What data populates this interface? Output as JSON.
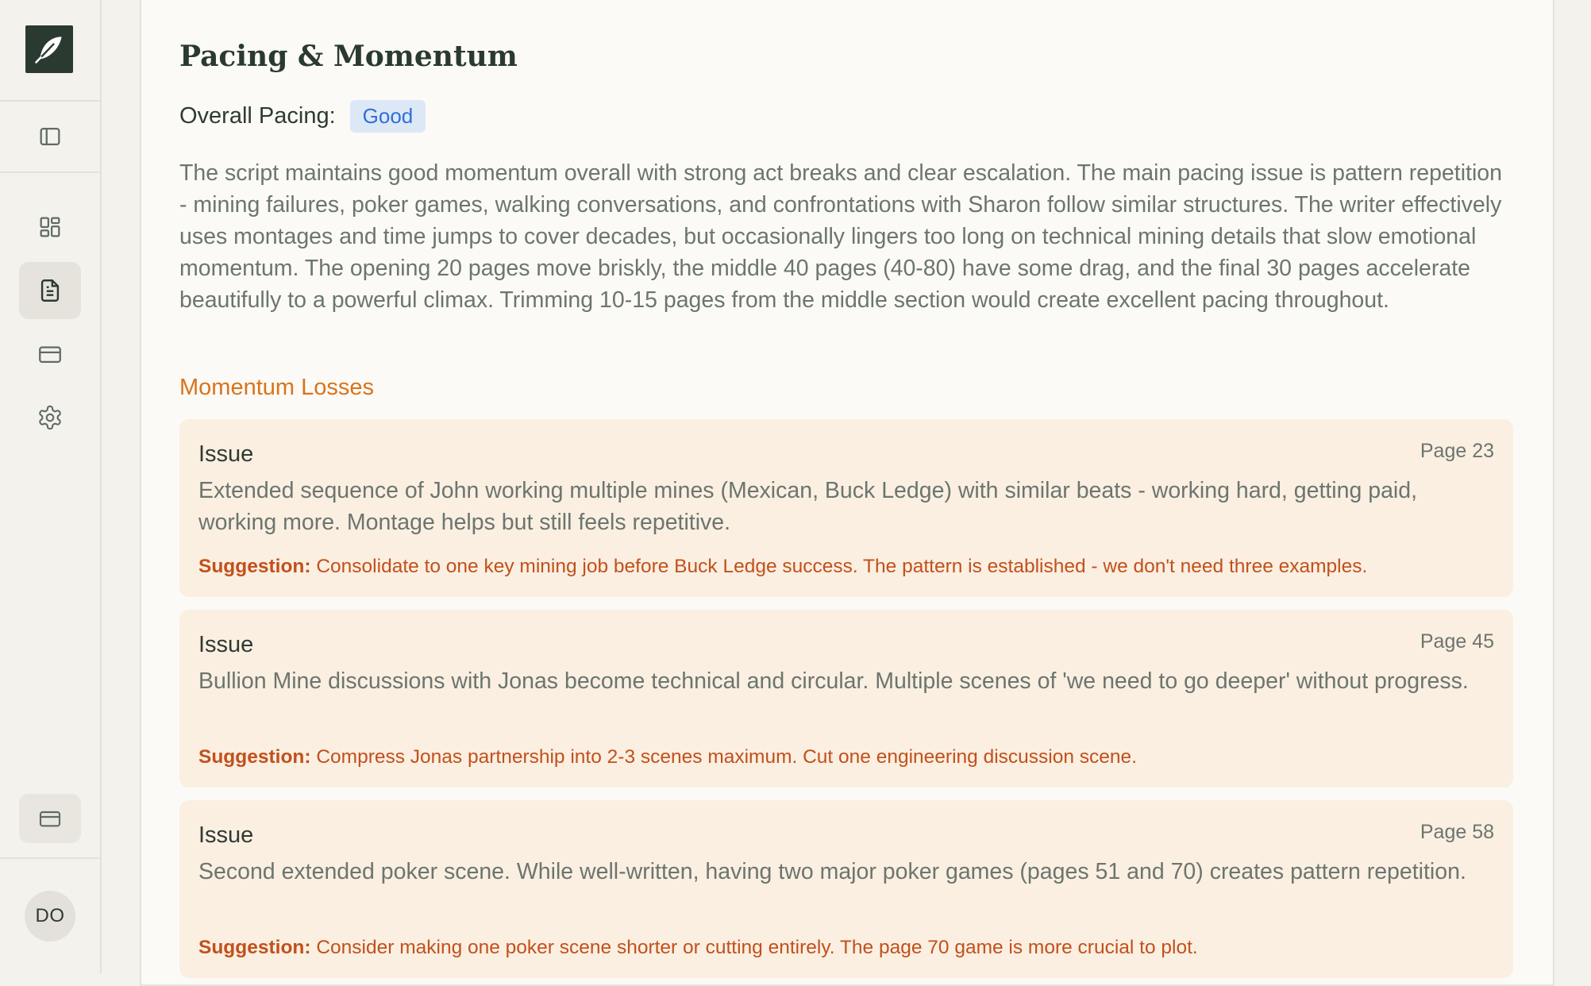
{
  "sidebar": {
    "logo_icon": "feather-icon",
    "toggle_icon": "sidebar-toggle-icon",
    "nav": [
      {
        "icon": "dashboard-icon",
        "active": false
      },
      {
        "icon": "document-icon",
        "active": true
      },
      {
        "icon": "credit-card-icon",
        "active": false
      },
      {
        "icon": "gear-icon",
        "active": false
      }
    ],
    "bottom_icon": "credit-card-icon",
    "avatar_initials": "DO"
  },
  "main": {
    "title": "Pacing & Momentum",
    "pacing_label": "Overall Pacing:",
    "pacing_value": "Good",
    "summary": "The script maintains good momentum overall with strong act breaks and clear escalation. The main pacing issue is pattern repetition - mining failures, poker games, walking conversations, and confrontations with Sharon follow similar structures. The writer effectively uses montages and time jumps to cover decades, but occasionally lingers too long on technical mining details that slow emotional momentum. The opening 20 pages move briskly, the middle 40 pages (40-80) have some drag, and the final 30 pages accelerate beautifully to a powerful climax. Trimming 10-15 pages from the middle section would create excellent pacing throughout.",
    "momentum_heading": "Momentum Losses",
    "issues": [
      {
        "label": "Issue",
        "page": "Page 23",
        "description": "Extended sequence of John working multiple mines (Mexican, Buck Ledge) with similar beats - working hard, getting paid, working more. Montage helps but still feels repetitive.",
        "suggestion_label": "Suggestion:",
        "suggestion": "Consolidate to one key mining job before Buck Ledge success. The pattern is established - we don't need three examples."
      },
      {
        "label": "Issue",
        "page": "Page 45",
        "description": "Bullion Mine discussions with Jonas become technical and circular. Multiple scenes of 'we need to go deeper' without progress.",
        "suggestion_label": "Suggestion:",
        "suggestion": "Compress Jonas partnership into 2-3 scenes maximum. Cut one engineering discussion scene."
      },
      {
        "label": "Issue",
        "page": "Page 58",
        "description": "Second extended poker scene. While well-written, having two major poker games (pages 51 and 70) creates pattern repetition.",
        "suggestion_label": "Suggestion:",
        "suggestion": "Consider making one poker scene shorter or cutting entirely. The page 70 game is more crucial to plot."
      }
    ]
  },
  "colors": {
    "brand_dark": "#2b3a30",
    "accent_orange": "#d9731a",
    "suggestion_text": "#c2501c",
    "badge_bg": "#dde8f7",
    "badge_text": "#2f6fd6",
    "card_bg": "#faefe1"
  }
}
